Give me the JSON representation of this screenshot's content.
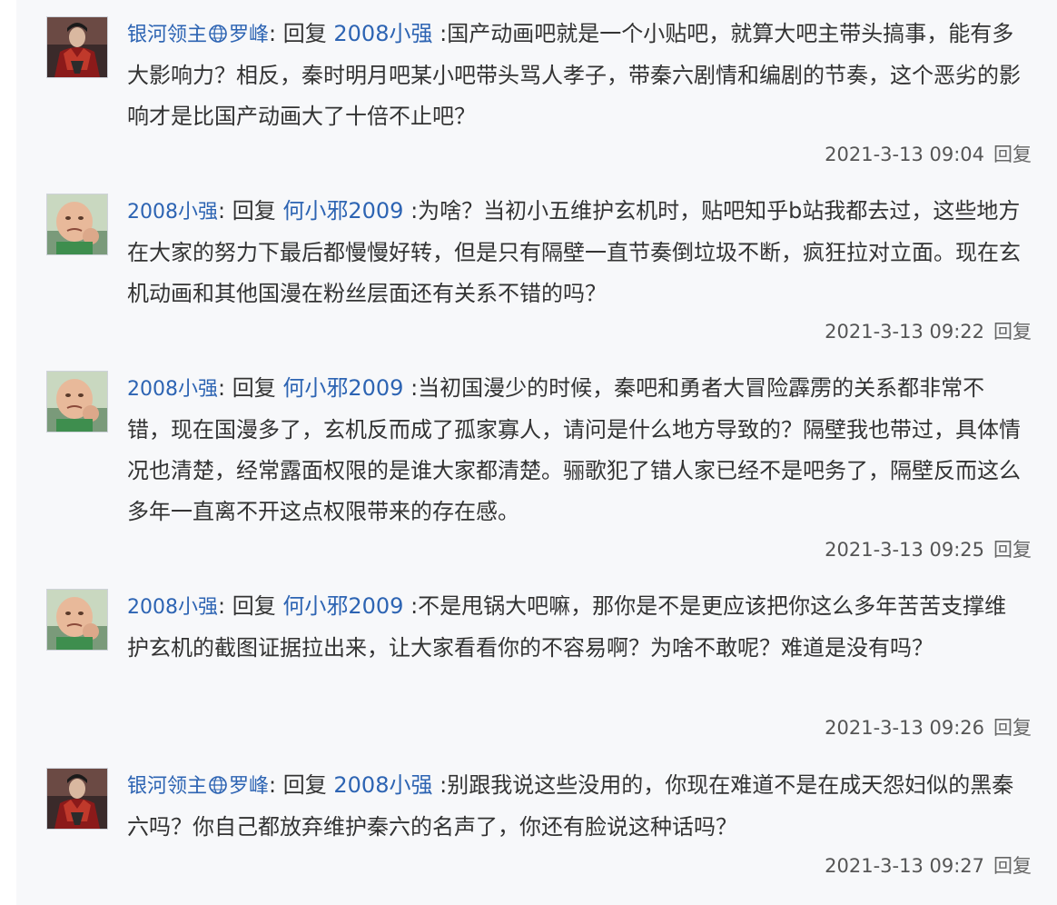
{
  "reply_label": "回复",
  "replies": [
    {
      "user_prefix": "银河领主",
      "user_suffix": "罗峰",
      "user_has_icon": true,
      "avatar": "armored-warrior",
      "target": "2008小强",
      "text": ":国产动画吧就是一个小贴吧，就算大吧主带头搞事，能有多大影响力？相反，秦时明月吧某小吧带头骂人孝子，带秦六剧情和编剧的节奏，这个恶劣的影响才是比国产动画大了十倍不止吧？",
      "time": "2021-3-13 09:04",
      "reply_btn": "回复"
    },
    {
      "user_prefix": "2008小强",
      "user_suffix": "",
      "user_has_icon": false,
      "avatar": "baby-fist",
      "target": "何小邪2009",
      "text": ":为啥？当初小五维护玄机时，贴吧知乎b站我都去过，这些地方在大家的努力下最后都慢慢好转，但是只有隔壁一直节奏倒垃圾不断，疯狂拉对立面。现在玄机动画和其他国漫在粉丝层面还有关系不错的吗？",
      "time": "2021-3-13 09:22",
      "reply_btn": "回复"
    },
    {
      "user_prefix": "2008小强",
      "user_suffix": "",
      "user_has_icon": false,
      "avatar": "baby-fist",
      "target": "何小邪2009",
      "text": ":当初国漫少的时候，秦吧和勇者大冒险霹雳的关系都非常不错，现在国漫多了，玄机反而成了孤家寡人，请问是什么地方导致的？隔壁我也带过，具体情况也清楚，经常露面权限的是谁大家都清楚。骊歌犯了错人家已经不是吧务了，隔壁反而这么多年一直离不开这点权限带来的存在感。",
      "time": "2021-3-13 09:25",
      "reply_btn": "回复"
    },
    {
      "user_prefix": "2008小强",
      "user_suffix": "",
      "user_has_icon": false,
      "avatar": "baby-fist",
      "target": "何小邪2009",
      "text": ":不是甩锅大吧嘛，那你是不是更应该把你这么多年苦苦支撑维护玄机的截图证据拉出来，让大家看看你的不容易啊？为啥不敢呢？难道是没有吗？",
      "time": "2021-3-13 09:26",
      "reply_btn": "回复"
    },
    {
      "user_prefix": "银河领主",
      "user_suffix": "罗峰",
      "user_has_icon": true,
      "avatar": "armored-warrior",
      "target": "2008小强",
      "text": ":别跟我说这些没用的，你现在难道不是在成天怨妇似的黑秦六吗？你自己都放弃维护秦六的名声了，你还有脸说这种话吗？",
      "time": "2021-3-13 09:27",
      "reply_btn": "回复"
    }
  ]
}
